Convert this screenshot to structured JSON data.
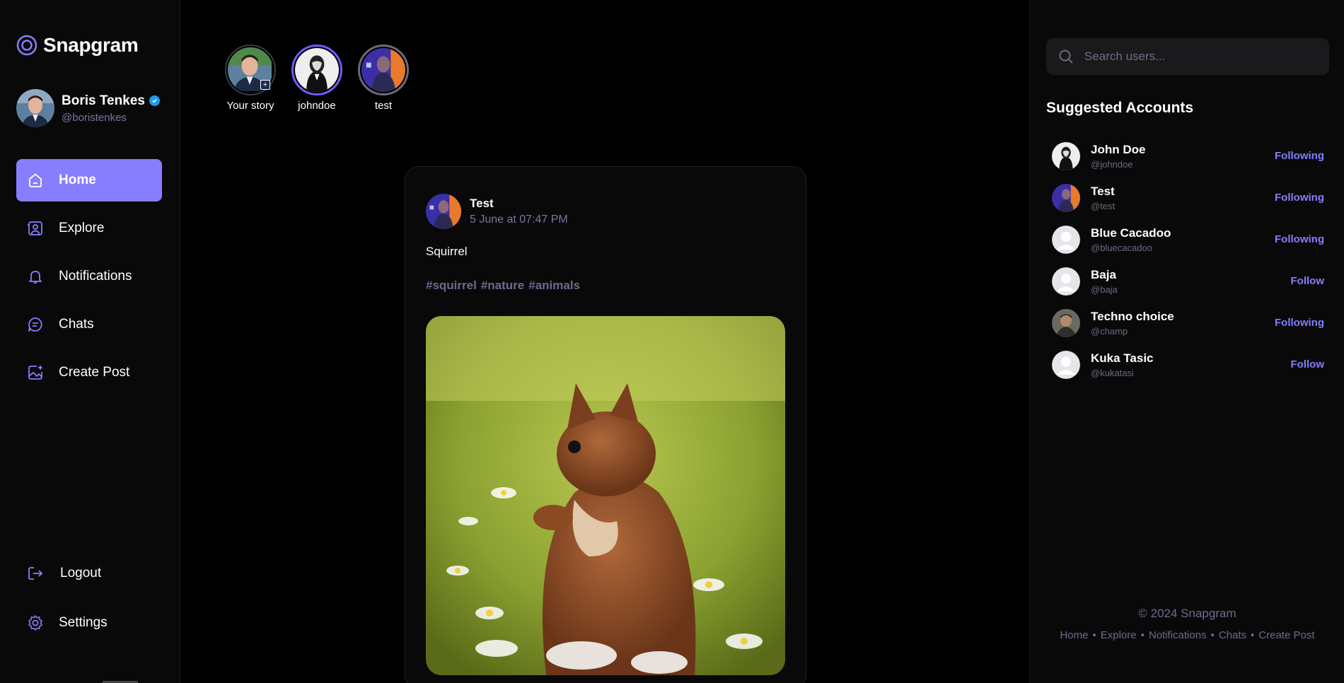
{
  "app": {
    "name": "Snapgram",
    "brand_color": "#877eff",
    "accent_purple": "#6d5cff"
  },
  "current_user": {
    "name": "Boris Tenkes",
    "handle": "@boristenkes",
    "verified": true
  },
  "nav": {
    "items": [
      {
        "label": "Home",
        "icon": "home-icon",
        "active": true
      },
      {
        "label": "Explore",
        "icon": "explore-icon",
        "active": false
      },
      {
        "label": "Notifications",
        "icon": "bell-icon",
        "active": false
      },
      {
        "label": "Chats",
        "icon": "chat-icon",
        "active": false
      },
      {
        "label": "Create Post",
        "icon": "create-post-icon",
        "active": false
      }
    ],
    "logout_label": "Logout",
    "settings_label": "Settings"
  },
  "stories": [
    {
      "label": "Your story",
      "kind": "own"
    },
    {
      "label": "johndoe",
      "kind": "new"
    },
    {
      "label": "test",
      "kind": "seen"
    }
  ],
  "post": {
    "author": "Test",
    "date": "5 June at 07:47 PM",
    "caption": "Squirrel",
    "tags": [
      "#squirrel",
      "#nature",
      "#animals"
    ],
    "image": "squirrel-photo"
  },
  "search": {
    "placeholder": "Search users..."
  },
  "suggested": {
    "title": "Suggested Accounts",
    "accounts": [
      {
        "name": "John Doe",
        "handle": "@johndoe",
        "action": "Following"
      },
      {
        "name": "Test",
        "handle": "@test",
        "action": "Following"
      },
      {
        "name": "Blue Cacadoo",
        "handle": "@bluecacadoo",
        "action": "Following"
      },
      {
        "name": "Baja",
        "handle": "@baja",
        "action": "Follow"
      },
      {
        "name": "Techno choice",
        "handle": "@champ",
        "action": "Following"
      },
      {
        "name": "Kuka Tasic",
        "handle": "@kukatasi",
        "action": "Follow"
      }
    ]
  },
  "footer": {
    "copyright": "© 2024 Snapgram",
    "links": [
      "Home",
      "Explore",
      "Notifications",
      "Chats",
      "Create Post"
    ]
  }
}
